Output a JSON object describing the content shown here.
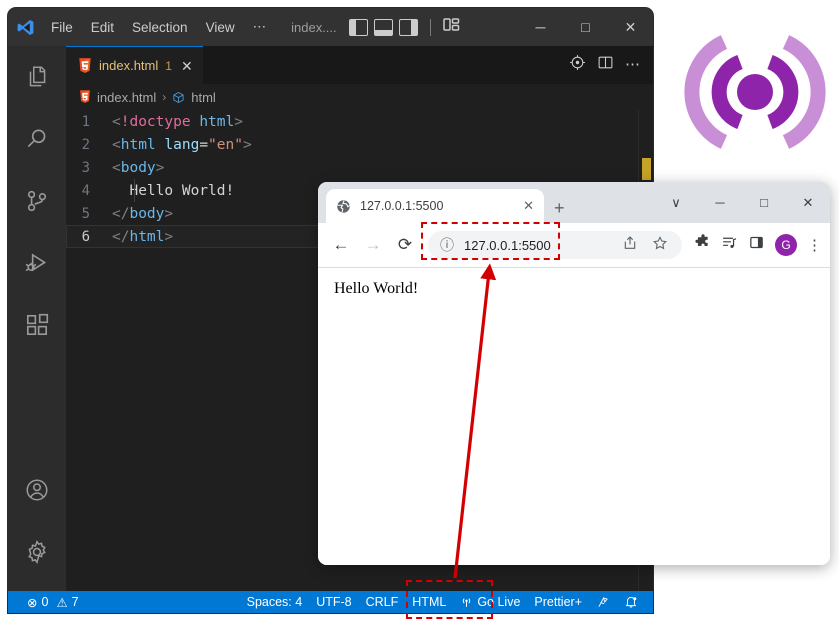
{
  "vscode": {
    "titlebar": {
      "menus": [
        "File",
        "Edit",
        "Selection",
        "View"
      ],
      "overflow": "⋯",
      "window_title": "index....",
      "layout_icons": [
        "toggle-primary-sidebar",
        "toggle-panel",
        "toggle-secondary-sidebar",
        "customize-layout"
      ],
      "controls": {
        "minimize": "─",
        "maximize": "□",
        "close": "✕"
      }
    },
    "activitybar": {
      "items": [
        "explorer-icon",
        "search-icon",
        "source-control-icon",
        "run-debug-icon",
        "extensions-icon",
        "account-icon",
        "settings-icon"
      ]
    },
    "tab": {
      "filename": "index.html",
      "badge": "1",
      "close": "✕",
      "actions": [
        "open-preview-icon",
        "split-editor-icon",
        "more-actions-icon"
      ]
    },
    "breadcrumb": {
      "file": "index.html",
      "separator": "›",
      "symbol": "html"
    },
    "code": {
      "lines": [
        {
          "n": "1",
          "active": false
        },
        {
          "n": "2",
          "active": false
        },
        {
          "n": "3",
          "active": false
        },
        {
          "n": "4",
          "active": false
        },
        {
          "n": "5",
          "active": false
        },
        {
          "n": "6",
          "active": true
        }
      ],
      "text": [
        "<!doctype html>",
        "<html lang=\"en\">",
        "<body>",
        "  Hello World!",
        "</body>",
        "</html>"
      ]
    },
    "statusbar": {
      "errors": "0",
      "warnings": "7",
      "error_icon": "⊗",
      "warning_icon": "⚠",
      "items": [
        "Spaces: 4",
        "UTF-8",
        "CRLF",
        "HTML"
      ],
      "go_live": "Go Live",
      "prettier": "Prettier+",
      "right_icons": [
        "remote-share-icon",
        "notifications-bell-icon"
      ],
      "accent": "#0078d4"
    }
  },
  "chrome": {
    "tab": {
      "title": "127.0.0.1:5500",
      "favicon": "globe-icon",
      "close": "✕"
    },
    "newtab": "+",
    "controls": {
      "tab_search": "∨",
      "minimize": "─",
      "maximize": "□",
      "close": "✕"
    },
    "toolbar": {
      "back": "←",
      "forward": "→",
      "reload": "⟳",
      "site_info": "ⓘ",
      "url": "127.0.0.1:5500",
      "share_icon": "share-icon",
      "bookmark_icon": "star-icon",
      "extensions_icon": "puzzle-icon",
      "reading_list_icon": "reading-list-icon",
      "side_panel_icon": "side-panel-icon",
      "profile_initial": "G",
      "profile_color": "#8e24aa",
      "menu": "⋮"
    },
    "page": {
      "body_text": "Hello World!"
    }
  },
  "annotations": {
    "arrow_color": "#d40000",
    "highlight_url_bar": true,
    "highlight_go_live": true
  },
  "logo": {
    "name": "live-server-broadcast-logo",
    "inner_color": "#8e24aa",
    "outer_color": "#c98fd6"
  }
}
